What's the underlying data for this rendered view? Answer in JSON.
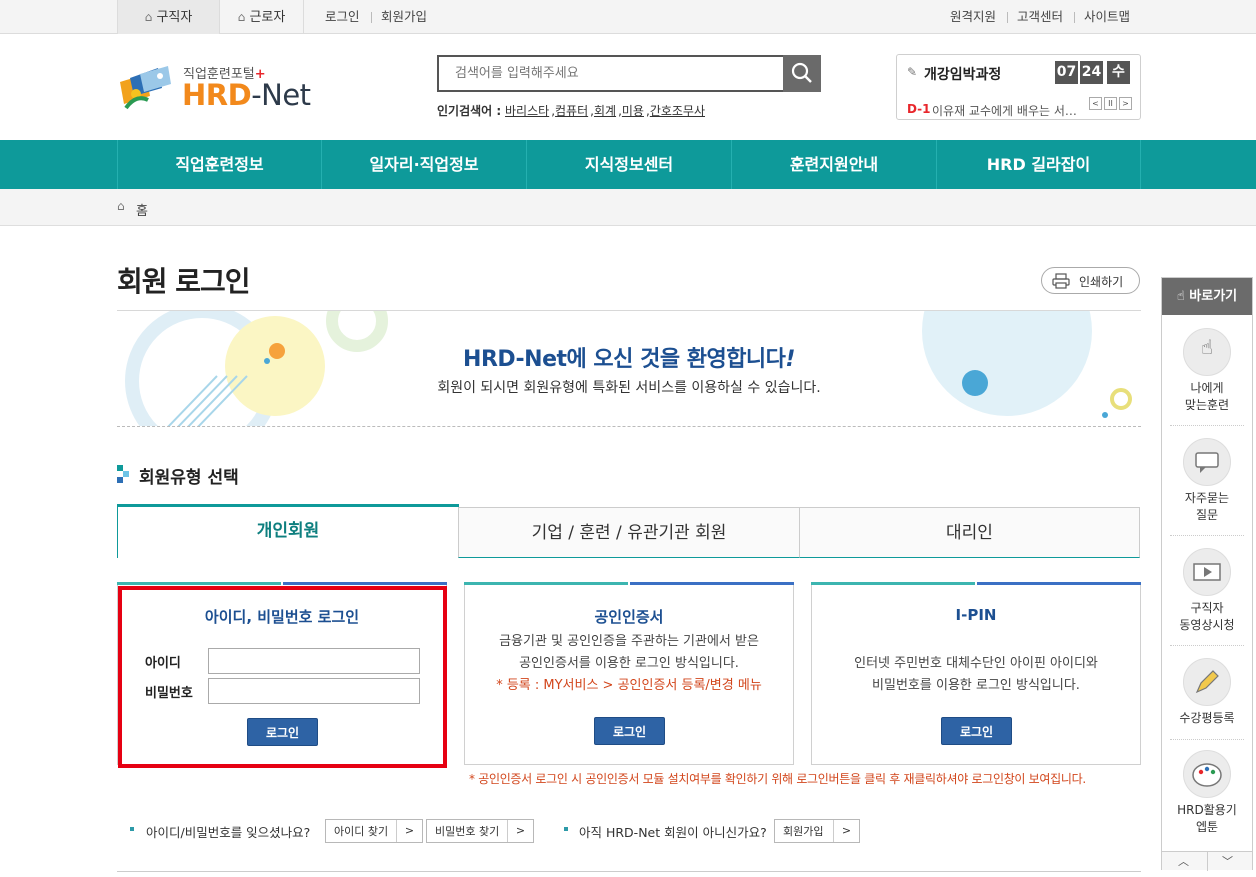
{
  "topbar": {
    "tabs": [
      "구직자",
      "근로자"
    ],
    "links_left": [
      "로그인",
      "회원가입"
    ],
    "links_right": [
      "원격지원",
      "고객센터",
      "사이트맵"
    ]
  },
  "logo": {
    "sub": "직업훈련포털",
    "plus": "+",
    "name_a": "HRD",
    "name_b": "-Net"
  },
  "search": {
    "placeholder": "검색어를 입력해주세요",
    "popular_label": "인기검색어 :",
    "popular": [
      "바리스타",
      "컴퓨터",
      "회계",
      "미용",
      "간호조무사"
    ]
  },
  "course": {
    "title": "개강임박과정",
    "digits": [
      "07",
      "24",
      "수"
    ],
    "dday": "D-1",
    "text": "이유재 교수에게 배우는 서…",
    "nav": [
      "<",
      "II",
      ">"
    ]
  },
  "gnb": [
    "직업훈련정보",
    "일자리·직업정보",
    "지식정보센터",
    "훈련지원안내",
    "HRD 길라잡이"
  ],
  "breadcrumb": "홈",
  "page": {
    "title": "회원 로그인",
    "print": "인쇄하기"
  },
  "banner": {
    "headline": "HRD-Net에 오신 것을 환영합니다",
    "excl": "!",
    "sub": "회원이 되시면 회원유형에 특화된 서비스를 이용하실 수 있습니다."
  },
  "section": {
    "title": "회원유형 선택"
  },
  "tabs": [
    "개인회원",
    "기업 / 훈련 / 유관기관 회원",
    "대리인"
  ],
  "box_id": {
    "title": "아이디, 비밀번호 로그인",
    "id_label": "아이디",
    "pw_label": "비밀번호",
    "button": "로그인"
  },
  "box_cert": {
    "title": "공인인증서",
    "desc1": "금융기관 및 공인인증을 주관하는 기관에서 받은",
    "desc2": "공인인증서를 이용한 로그인 방식입니다.",
    "reg": "* 등록 : MY서비스 > 공인인증서 등록/변경 메뉴",
    "button": "로그인"
  },
  "box_ipin": {
    "title": "I-PIN",
    "desc1": "인터넷 주민번호 대체수단인 아이핀 아이디와",
    "desc2": "비밀번호를 이용한 로그인 방식입니다.",
    "button": "로그인"
  },
  "note": "* 공인인증서 로그인 시 공인인증서 모듈 설치여부를 확인하기 위해 로그인버튼을 클릭 후 재클릭하셔야 로그인창이 보여집니다.",
  "bottom": {
    "forgot": "아이디/비밀번호를 잊으셨나요?",
    "find_id": "아이디 찾기",
    "find_pw": "비밀번호 찾기",
    "notmember": "아직 HRD-Net 회원이 아니신가요?",
    "join": "회원가입",
    "chev": ">"
  },
  "quick": {
    "title": "바로가기",
    "items": [
      {
        "l1": "나에게",
        "l2": "맞는훈련"
      },
      {
        "l1": "자주묻는",
        "l2": "질문"
      },
      {
        "l1": "구직자",
        "l2": "동영상시청"
      },
      {
        "l1": "수강평등록",
        "l2": ""
      },
      {
        "l1": "HRD활용기",
        "l2": "엡툰"
      }
    ]
  },
  "colors": {
    "teal": "#0e9a9a",
    "navy": "#1c4f91",
    "orange": "#f2891c",
    "red": "#e60012",
    "button": "#2e63a5"
  }
}
